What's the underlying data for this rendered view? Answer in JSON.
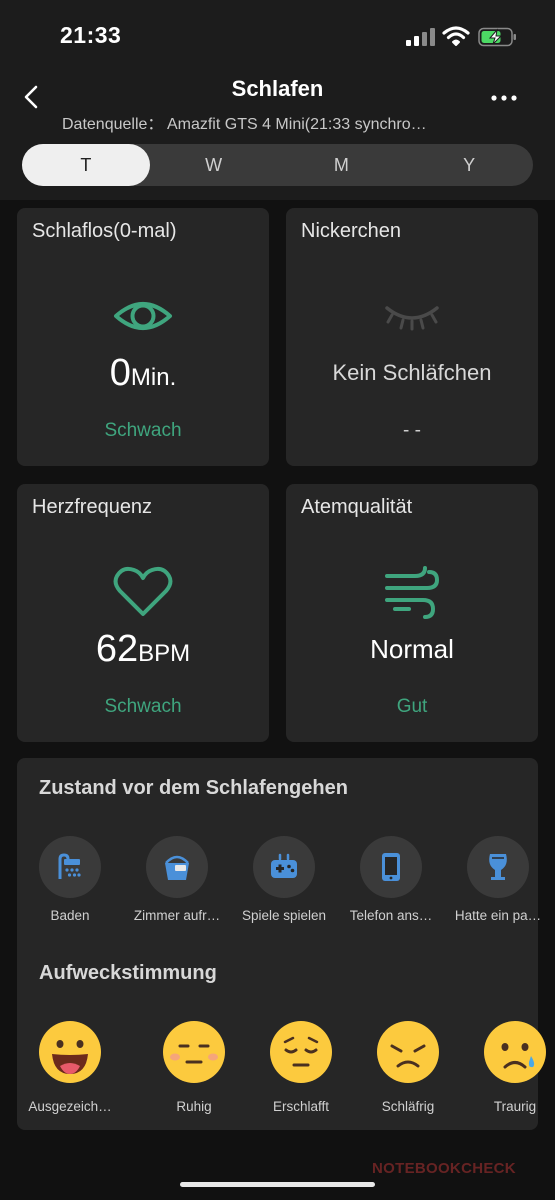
{
  "status": {
    "time": "21:33"
  },
  "header": {
    "title": "Schlafen",
    "subtitle": "Datenquelle：  Amazfit GTS 4 Mini(21:33 synchro…"
  },
  "tabs": [
    {
      "label": "T",
      "active": true
    },
    {
      "label": "W",
      "active": false
    },
    {
      "label": "M",
      "active": false
    },
    {
      "label": "Y",
      "active": false
    }
  ],
  "cards": {
    "awake": {
      "title": "Schlaflos(0-mal)",
      "value": "0",
      "unit": "Min.",
      "status": "Schwach"
    },
    "nap": {
      "title": "Nickerchen",
      "value": "Kein Schläfchen",
      "status": "- -"
    },
    "heart": {
      "title": "Herzfrequenz",
      "value": "62",
      "unit": "BPM",
      "status": "Schwach"
    },
    "breath": {
      "title": "Atemqualität",
      "value": "Normal",
      "status": "Gut"
    }
  },
  "before_sleep": {
    "title": "Zustand vor dem Schlafengehen",
    "items": [
      {
        "label": "Baden",
        "icon": "shower-icon"
      },
      {
        "label": "Zimmer aufr…",
        "icon": "bucket-icon"
      },
      {
        "label": "Spiele spielen",
        "icon": "gamepad-icon"
      },
      {
        "label": "Telefon ans…",
        "icon": "phone-icon"
      },
      {
        "label": "Hatte ein pa…",
        "icon": "wine-glass-icon"
      }
    ]
  },
  "wake_mood": {
    "title": "Aufweckstimmung",
    "items": [
      {
        "label": "Ausgezeich…",
        "icon": "laughing-face-icon"
      },
      {
        "label": "Ruhig",
        "icon": "neutral-face-icon"
      },
      {
        "label": "Erschlafft",
        "icon": "tired-face-icon"
      },
      {
        "label": "Schläfrig",
        "icon": "sleepy-face-icon"
      },
      {
        "label": "Traurig",
        "icon": "crying-face-icon"
      }
    ]
  },
  "watermark": "NOTEBOOKCHECK",
  "colors": {
    "accent": "#3fa57e",
    "icon_blue": "#4a90d9",
    "background": "#111111",
    "card": "#262626"
  }
}
